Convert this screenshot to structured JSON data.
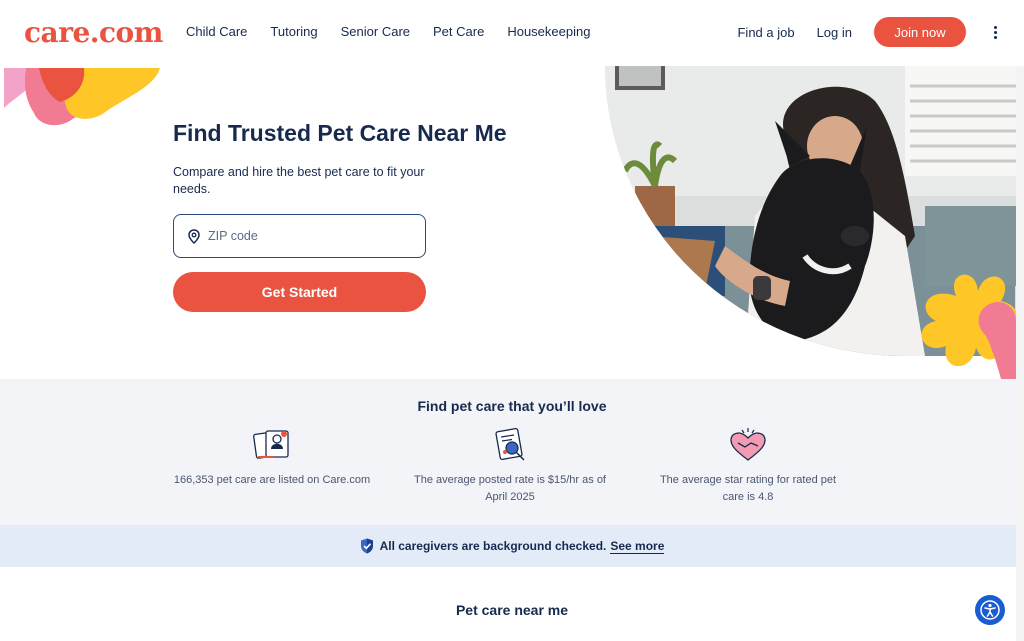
{
  "header": {
    "logo": "care.com",
    "nav": [
      "Child Care",
      "Tutoring",
      "Senior Care",
      "Pet Care",
      "Housekeeping"
    ],
    "find_job": "Find a job",
    "login": "Log in",
    "join": "Join now"
  },
  "hero": {
    "title": "Find Trusted Pet Care Near Me",
    "subtitle": "Compare and hire the best pet care to fit your needs.",
    "zip_placeholder": "ZIP code",
    "cta": "Get Started"
  },
  "stats": {
    "title": "Find pet care that you’ll love",
    "items": [
      {
        "icon": "profile-cards-icon",
        "text": "166,353 pet care are listed on Care.com"
      },
      {
        "icon": "rate-document-icon",
        "text": "The average posted rate is $15/hr as of April 2025"
      },
      {
        "icon": "heart-handshake-icon",
        "text": "The average star rating for rated pet care is 4.8"
      }
    ]
  },
  "banner": {
    "text": "All caregivers are background checked.",
    "link": "See more"
  },
  "near": {
    "title": "Pet care near me"
  },
  "colors": {
    "brand": "#e9533f",
    "navy": "#172a4e",
    "stats_bg": "#f2f4f7",
    "banner_bg": "#e3ebf8",
    "a11y_blue": "#1a5cd1"
  }
}
